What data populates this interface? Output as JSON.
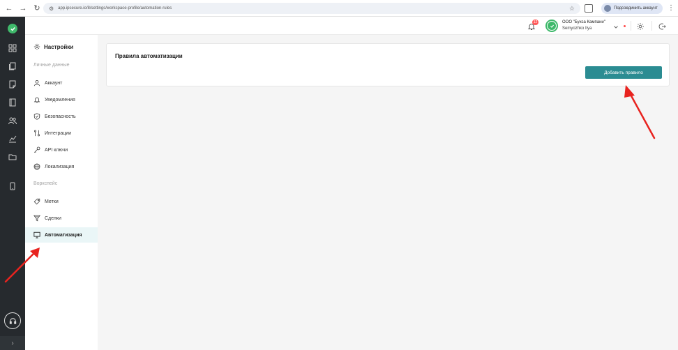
{
  "browser": {
    "url": "app.ipsecure.io/8/settings/workspace-profile/automation-rules",
    "profile_label": "Подсоединить аккаунт"
  },
  "header": {
    "notification_count": "12",
    "company_name": "ООО \"Бухса Кампани\"",
    "user_name": "Semyozhko Ilya"
  },
  "settings_sidebar": {
    "title": "Настройки",
    "sections": [
      {
        "label": "Личные данные",
        "items": [
          {
            "label": "Аккаунт",
            "icon": "user-icon"
          },
          {
            "label": "Уведомления",
            "icon": "bell-icon"
          },
          {
            "label": "Безопасность",
            "icon": "shield-icon"
          },
          {
            "label": "Интеграции",
            "icon": "integration-icon"
          },
          {
            "label": "API ключи",
            "icon": "key-icon"
          },
          {
            "label": "Локализация",
            "icon": "globe-icon"
          }
        ]
      },
      {
        "label": "Воркспейс",
        "items": [
          {
            "label": "Метки",
            "icon": "tag-icon"
          },
          {
            "label": "Сделки",
            "icon": "funnel-icon"
          },
          {
            "label": "Автоматизация",
            "icon": "monitor-icon",
            "active": true
          }
        ]
      }
    ]
  },
  "main": {
    "card_title": "Правила автоматизации",
    "add_button_label": "Добавить правило"
  },
  "colors": {
    "rail_bg": "#262a2e",
    "accent": "#2b8c92",
    "brand_green": "#3fb96b",
    "active_item_bg": "#eaf6f7",
    "annotation_red": "#e8231f"
  }
}
